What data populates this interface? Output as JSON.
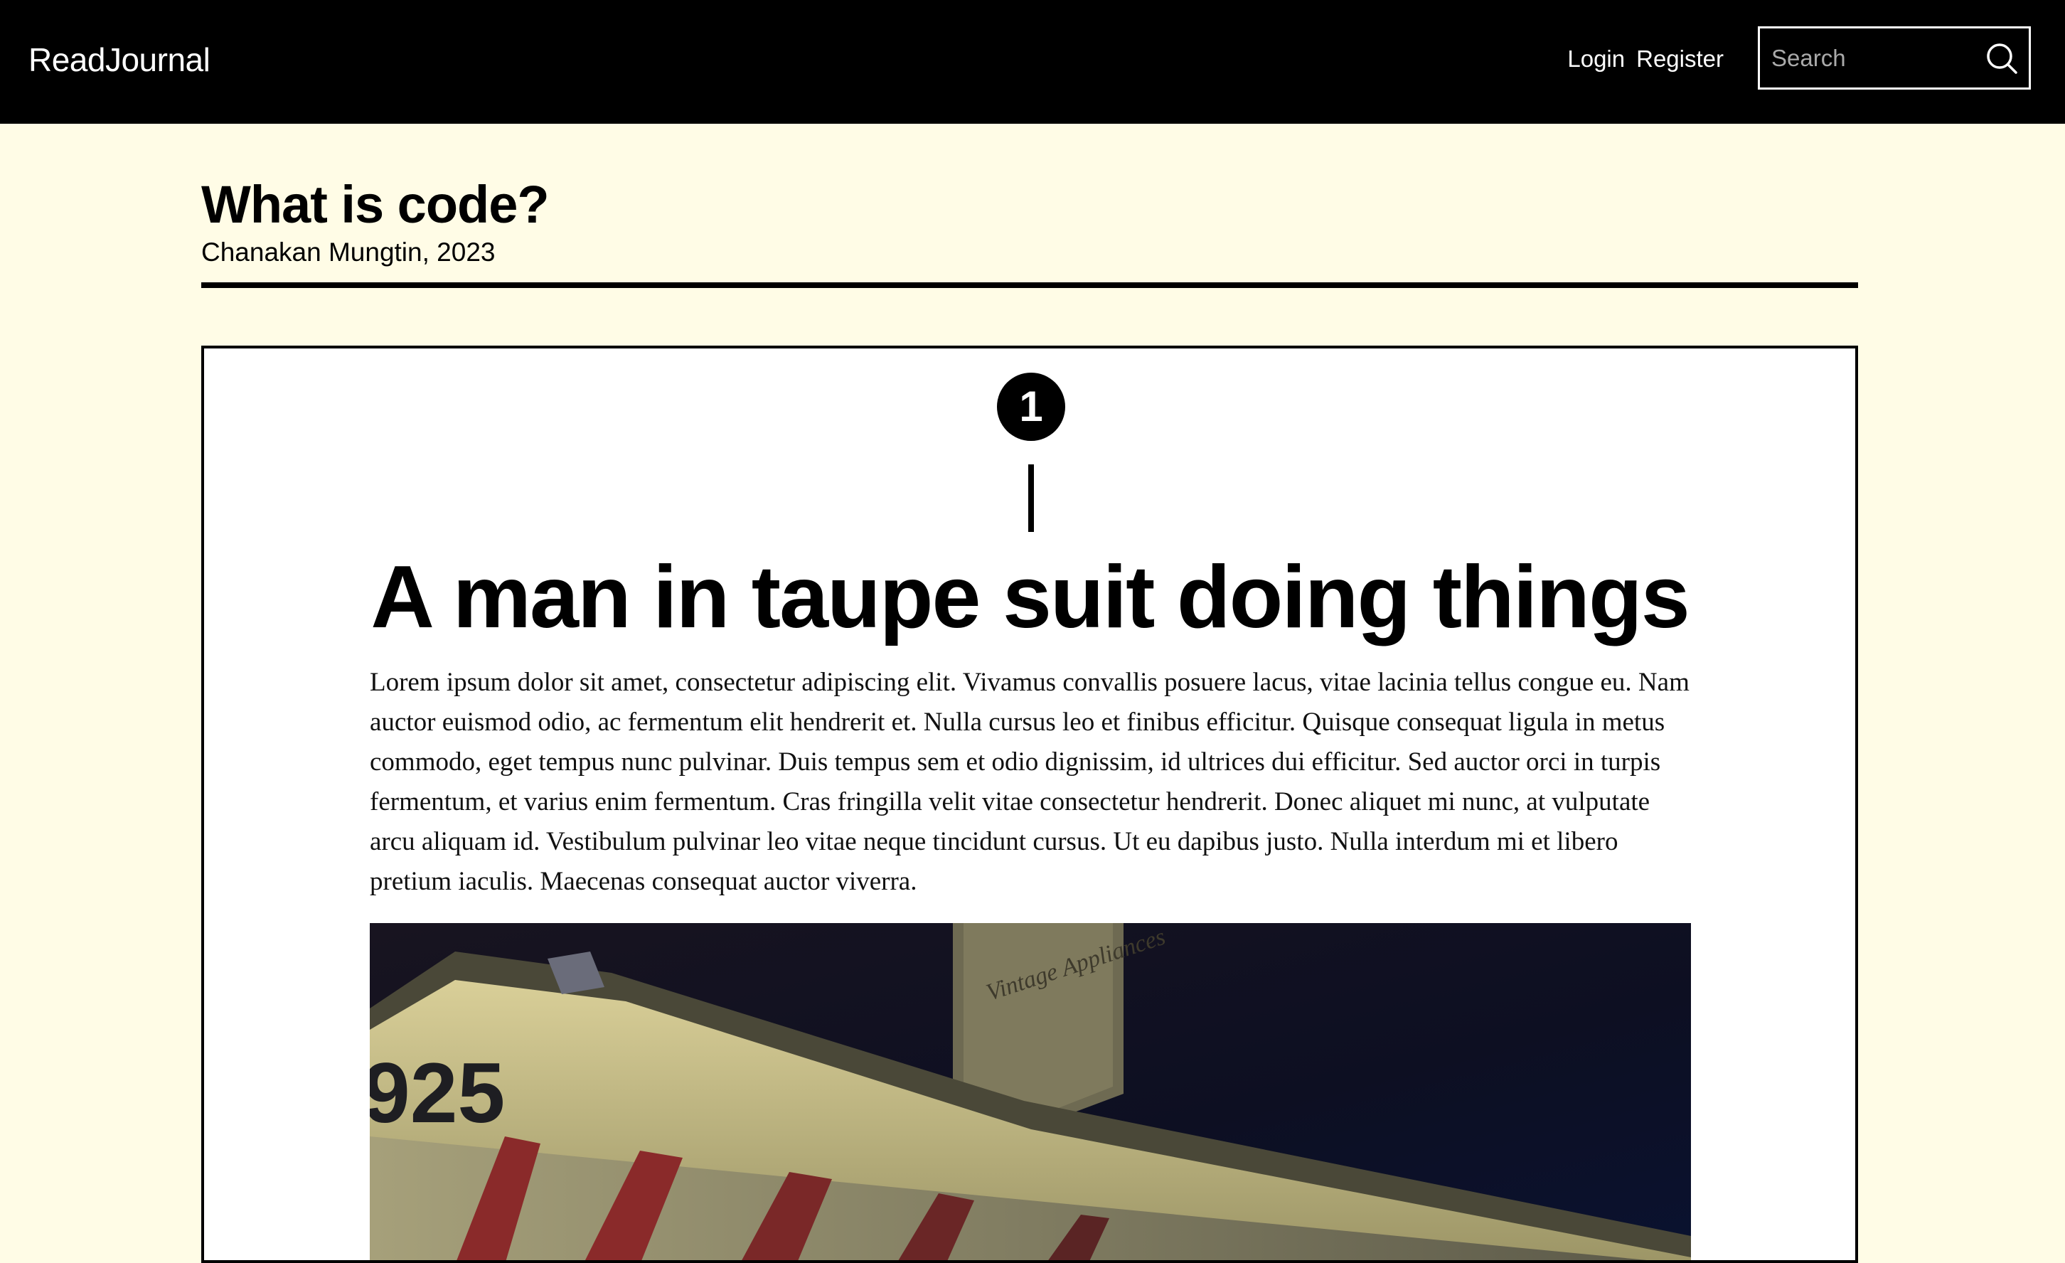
{
  "navbar": {
    "brand": "ReadJournal",
    "login_label": "Login",
    "register_label": "Register",
    "search_placeholder": "Search",
    "search_icon": "search-icon"
  },
  "header": {
    "title": "What is code?",
    "byline": "Chanakan Mungtin, 2023"
  },
  "section": {
    "step_number": "1",
    "heading": "A man in taupe suit doing things",
    "body": "Lorem ipsum dolor sit amet, consectetur adipiscing elit. Vivamus convallis posuere lacus, vitae lacinia tellus congue eu. Nam auctor euismod odio, ac fermentum elit hendrerit et. Nulla cursus leo et finibus efficitur. Quisque consequat ligula in metus commodo, eget tempus nunc pulvinar. Duis tempus sem et odio dignissim, id ultrices dui efficitur. Sed auctor orci in turpis fermentum, et varius enim fermentum. Cras fringilla velit vitae consectetur hendrerit. Donec aliquet mi nunc, at vulputate arcu aliquam id. Vestibulum pulvinar leo vitae neque tincidunt cursus. Ut eu dapibus justo. Nulla interdum mi et libero pretium iaculis. Maecenas consequat auctor viverra.",
    "photo": {
      "number_text": "925",
      "sign_text": "Vintage Appliances"
    }
  },
  "colors": {
    "navbar_bg": "#000000",
    "page_bg": "#fffce6",
    "card_bg": "#ffffff",
    "text": "#000000"
  }
}
